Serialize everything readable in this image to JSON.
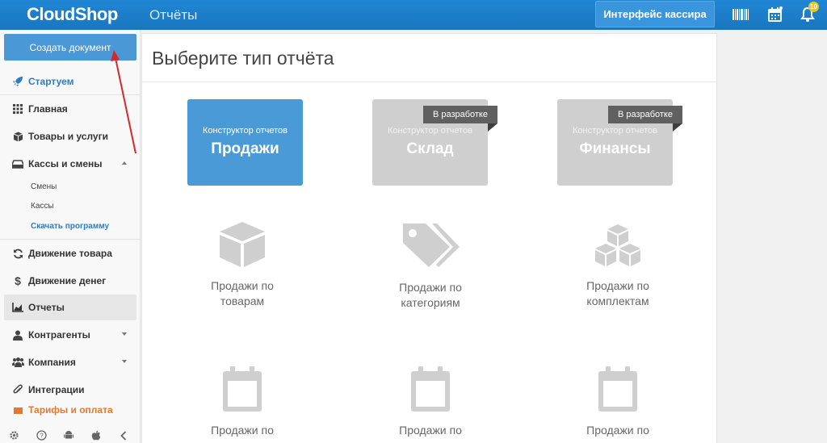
{
  "header": {
    "logo": "CloudShop",
    "page_title": "Отчёты",
    "cashier_button": "Интерфейс кассира",
    "notifications_count": "10",
    "icons": [
      "barcode-icon",
      "calendar-icon",
      "bell-icon"
    ]
  },
  "sidebar": {
    "create_button": "Создать документ",
    "items": [
      {
        "label": "Стартуем",
        "icon": "rocket-icon"
      },
      {
        "label": "Главная",
        "icon": "grid-icon"
      },
      {
        "label": "Товары и услуги",
        "icon": "box-icon"
      },
      {
        "label": "Кассы и смены",
        "icon": "cash-drawer-icon"
      },
      {
        "label": "Движение товара",
        "icon": "refresh-icon"
      },
      {
        "label": "Движение денег",
        "icon": "dollar-icon"
      },
      {
        "label": "Отчеты",
        "icon": "chart-icon"
      },
      {
        "label": "Контрагенты",
        "icon": "user-icon"
      },
      {
        "label": "Компания",
        "icon": "users-icon"
      },
      {
        "label": "Интеграции",
        "icon": "paperclip-icon"
      },
      {
        "label": "Тарифы и оплата",
        "icon": "gift-icon"
      }
    ],
    "subitems": [
      {
        "label": "Смены"
      },
      {
        "label": "Кассы"
      },
      {
        "label": "Скачать программу"
      }
    ],
    "bottom_icons": [
      "settings-icon",
      "help-icon",
      "android-icon",
      "apple-icon",
      "collapse-icon"
    ]
  },
  "main": {
    "title": "Выберите тип отчёта",
    "tiles": [
      {
        "small": "Конструктор отчетов",
        "big": "Продажи",
        "ribbon": ""
      },
      {
        "small": "Конструктор отчетов",
        "big": "Склад",
        "ribbon": "В разработке"
      },
      {
        "small": "Конструктор отчетов",
        "big": "Финансы",
        "ribbon": "В разработке"
      }
    ],
    "reports": [
      {
        "line1": "Продажи по",
        "line2": "товарам",
        "icon": "cube-icon"
      },
      {
        "line1": "Продажи по",
        "line2": "категориям",
        "icon": "tags-icon"
      },
      {
        "line1": "Продажи по",
        "line2": "комплектам",
        "icon": "cubes-icon"
      },
      {
        "line1": "Продажи по",
        "line2": "",
        "icon": "calendar-icon"
      },
      {
        "line1": "Продажи по",
        "line2": "",
        "icon": "calendar-icon"
      },
      {
        "line1": "Продажи по",
        "line2": "",
        "icon": "calendar-icon"
      }
    ]
  },
  "colors": {
    "header": "#1a7dc9",
    "accent": "#4a9ad8",
    "tile_disabled": "#cfcfcf",
    "ribbon": "#606060",
    "arrow": "#d42a2a"
  }
}
